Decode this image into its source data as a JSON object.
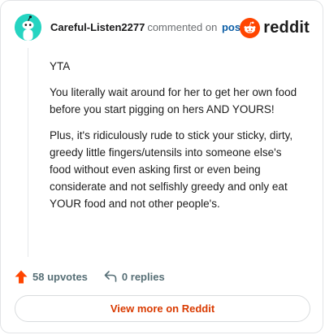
{
  "header": {
    "username": "Careful-Listen2277",
    "action_text": "commented on",
    "post_link": "post",
    "brand_word": "reddit"
  },
  "comment": {
    "paragraphs": [
      "YTA",
      "You literally wait around for her to get her own food before you start pigging on hers AND YOURS!",
      "Plus, it's ridiculously rude to stick your sticky, dirty, greedy little fingers/utensils into someone else's food without even asking first or even being considerate and not selfishly greedy and only eat YOUR food and not other people's."
    ]
  },
  "actions": {
    "upvotes_label": "58 upvotes",
    "replies_label": "0 replies"
  },
  "footer": {
    "view_more_label": "View more on Reddit"
  },
  "colors": {
    "avatar_bg": "#25d4c1",
    "reddit_orange": "#ff4500",
    "upvote_arrow": "#ff4500",
    "link_blue": "#0c5ea6",
    "cta_orange": "#d93a00"
  }
}
